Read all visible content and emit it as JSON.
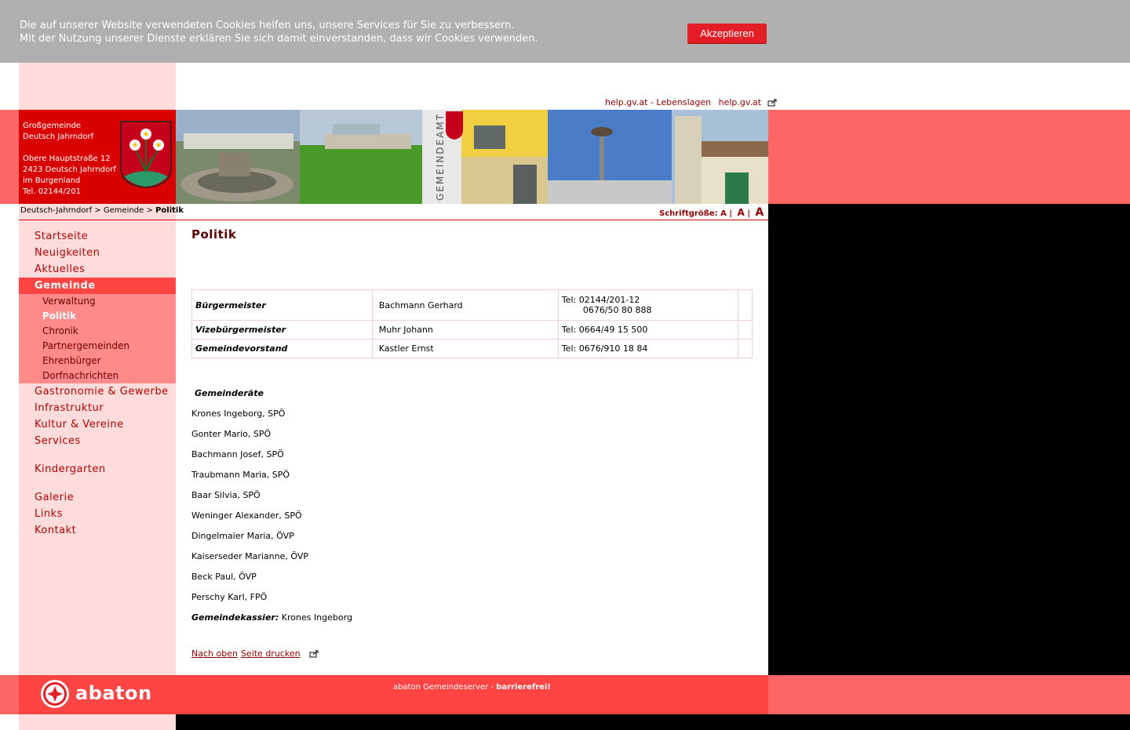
{
  "cookie": {
    "line1": "Die auf unserer Website verwendeten Cookies helfen uns, unsere Services für Sie zu verbessern.",
    "line2": "Mit der Nutzung unserer Dienste erklären Sie sich damit einverstanden, dass wir Cookies verwenden.",
    "accept_label": "Akzeptieren"
  },
  "toplinks": {
    "lebenslagen": "help.gv.at - Lebenslagen",
    "helpgv": "help.gv.at"
  },
  "address": {
    "line1": "Großgemeinde",
    "line2": "Deutsch Jahrndorf",
    "line3": "Obere Hauptstraße 12",
    "line4": "2423 Deutsch Jahrndorf",
    "line5": "im Burgenland",
    "line6": "Tel. 02144/201"
  },
  "photo_sign": "GEMEINDEAMT",
  "breadcrumb": {
    "item1": "Deutsch-Jahrndorf",
    "sep": ">",
    "item2": "Gemeinde",
    "current": "Politik"
  },
  "fontsize": {
    "label": "Schriftgröße:",
    "small": "A",
    "medium": "A",
    "large": "A",
    "sep": "|"
  },
  "nav": {
    "items": [
      "Startseite",
      "Neuigkeiten",
      "Aktuelles",
      "Gemeinde"
    ],
    "sub": [
      "Verwaltung",
      "Politik",
      "Chronik",
      "Partnergemeinden",
      "Ehrenbürger",
      "Dorfnachrichten"
    ],
    "items2": [
      "Gastronomie & Gewerbe",
      "Infrastruktur",
      "Kultur & Vereine",
      "Services"
    ],
    "kindergarten": "Kindergarten",
    "items3": [
      "Galerie",
      "Links",
      "Kontakt"
    ]
  },
  "content": {
    "title": "Politik",
    "officials": [
      {
        "role": "Bürgermeister",
        "name": "Bachmann Gerhard",
        "tel": "Tel: 02144/201-12",
        "tel2": "0676/50 80 888"
      },
      {
        "role": "Vizebürgermeister",
        "name": "Muhr Johann",
        "tel": "Tel: 0664/49 15 500",
        "tel2": ""
      },
      {
        "role": "Gemeindevorstand",
        "name": "Kastler Ernst",
        "tel": "Tel: 0676/910 18 84",
        "tel2": ""
      }
    ],
    "council_title": "Gemeinderäte",
    "members": [
      "Krones Ingeborg, SPÖ",
      "Gonter Mario, SPÖ",
      "Bachmann Josef, SPÖ",
      "Traubmann Maria, SPÖ",
      "Baar Silvia, SPÖ",
      "Weninger Alexander, SPÖ",
      "Dingelmaier Maria, ÖVP",
      "Kaiserseder Marianne, ÖVP",
      "Beck Paul, ÖVP",
      "Perschy Karl, FPÖ"
    ],
    "kassier_label": "Gemeindekassier:",
    "kassier_name": "Krones Ingeborg",
    "link_top": "Nach oben",
    "link_print": "Seite drucken"
  },
  "footer": {
    "text": "abaton Gemeindeserver -",
    "bold": "barrierefrei!",
    "logo_word": "abaton"
  },
  "colors": {
    "accent": "#d90000",
    "nav_active": "#ff4444",
    "subnav_bg": "#ff8a8a",
    "sidebar_bg": "#ffdcdc",
    "band": "#ff6666"
  }
}
